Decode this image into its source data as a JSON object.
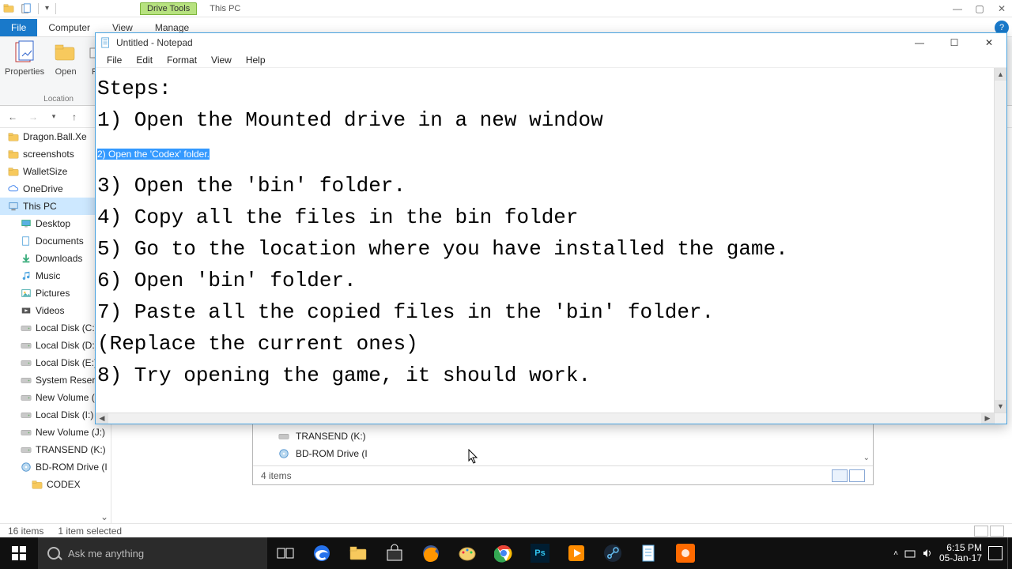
{
  "explorer_title": {
    "drive_tools": "Drive Tools",
    "this_pc": "This PC"
  },
  "tabs": {
    "file": "File",
    "computer": "Computer",
    "view": "View",
    "manage": "Manage"
  },
  "ribbon": {
    "properties": "Properties",
    "open": "Open",
    "rename": "Ren",
    "location": "Location"
  },
  "tree": [
    {
      "label": "Dragon.Ball.Xe",
      "icon": "folder"
    },
    {
      "label": "screenshots",
      "icon": "folder"
    },
    {
      "label": "WalletSize",
      "icon": "folder"
    },
    {
      "label": "OneDrive",
      "icon": "cloud"
    },
    {
      "label": "This PC",
      "icon": "pc",
      "selected": true
    },
    {
      "label": "Desktop",
      "icon": "desktop",
      "sub": true
    },
    {
      "label": "Documents",
      "icon": "docs",
      "sub": true
    },
    {
      "label": "Downloads",
      "icon": "down",
      "sub": true
    },
    {
      "label": "Music",
      "icon": "music",
      "sub": true
    },
    {
      "label": "Pictures",
      "icon": "pics",
      "sub": true
    },
    {
      "label": "Videos",
      "icon": "vids",
      "sub": true
    },
    {
      "label": "Local Disk (C:)",
      "icon": "drive",
      "sub": true
    },
    {
      "label": "Local Disk (D:)",
      "icon": "drive",
      "sub": true
    },
    {
      "label": "Local Disk (E:)",
      "icon": "drive",
      "sub": true
    },
    {
      "label": "System Reserv",
      "icon": "drive",
      "sub": true
    },
    {
      "label": "New Volume (",
      "icon": "drive",
      "sub": true
    },
    {
      "label": "Local Disk (I:)",
      "icon": "drive",
      "sub": true
    },
    {
      "label": "New Volume (J:)",
      "icon": "drive",
      "sub": true
    },
    {
      "label": "TRANSEND (K:)",
      "icon": "drive",
      "sub": true
    },
    {
      "label": "BD-ROM Drive (I",
      "icon": "odd",
      "sub": true
    },
    {
      "label": "CODEX",
      "icon": "folder",
      "subsub": true
    }
  ],
  "status": {
    "items": "16 items",
    "sel": "1 item selected"
  },
  "inner": {
    "rows": [
      "TRANSEND (K:)",
      "BD-ROM Drive (I"
    ],
    "items": "4 items"
  },
  "notepad": {
    "title": "Untitled - Notepad",
    "menu": [
      "File",
      "Edit",
      "Format",
      "View",
      "Help"
    ],
    "lines": [
      "Steps:",
      "1) Open the Mounted drive in a new window",
      "2) Open the 'Codex' folder.",
      "3) Open the 'bin' folder.",
      "4) Copy all the files in the bin folder",
      "5) Go to the location where you have installed the game.",
      "6) Open 'bin' folder.",
      "7) Paste all the copied files in the 'bin' folder.",
      "(Replace the current ones)",
      "8) Try opening the game, it should work."
    ],
    "highlight_index": 2
  },
  "taskbar": {
    "search_placeholder": "Ask me anything",
    "clock": {
      "time": "6:15 PM",
      "date": "05-Jan-17"
    }
  }
}
